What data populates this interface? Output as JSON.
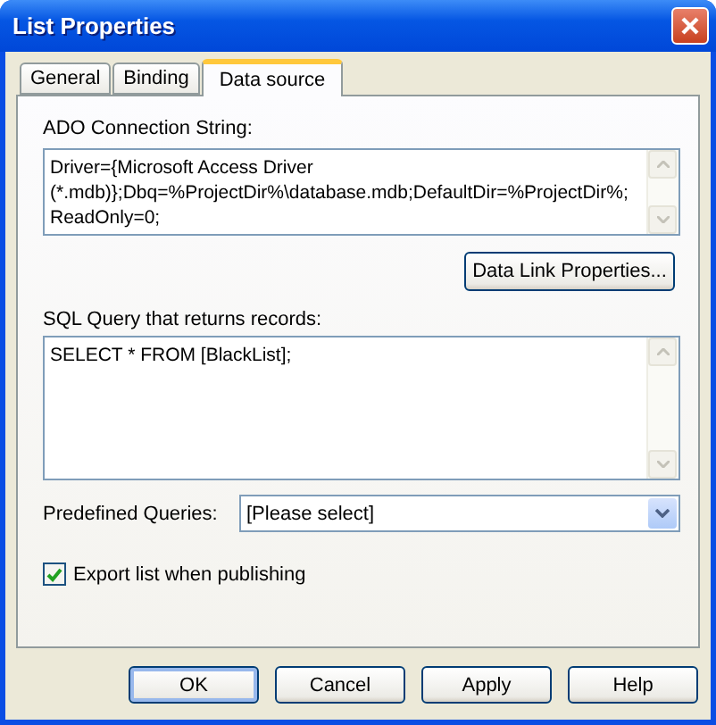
{
  "window": {
    "title": "List Properties"
  },
  "tabs": [
    {
      "label": "General",
      "selected": false
    },
    {
      "label": "Binding",
      "selected": false
    },
    {
      "label": "Data source",
      "selected": true
    }
  ],
  "connection": {
    "label": "ADO Connection String:",
    "value": "Driver={Microsoft Access Driver (*.mdb)};Dbq=%ProjectDir%\\database.mdb;DefaultDir=%ProjectDir%;ReadOnly=0;"
  },
  "data_link_button": "Data Link Properties...",
  "query": {
    "label": "SQL Query that returns records:",
    "value": "SELECT * FROM [BlackList];"
  },
  "predefined": {
    "label": "Predefined Queries:",
    "value": "[Please select]"
  },
  "export": {
    "label": "Export list when publishing",
    "checked": true
  },
  "buttons": [
    {
      "label": "OK",
      "default": true
    },
    {
      "label": "Cancel",
      "default": false
    },
    {
      "label": "Apply",
      "default": false
    },
    {
      "label": "Help",
      "default": false
    }
  ]
}
